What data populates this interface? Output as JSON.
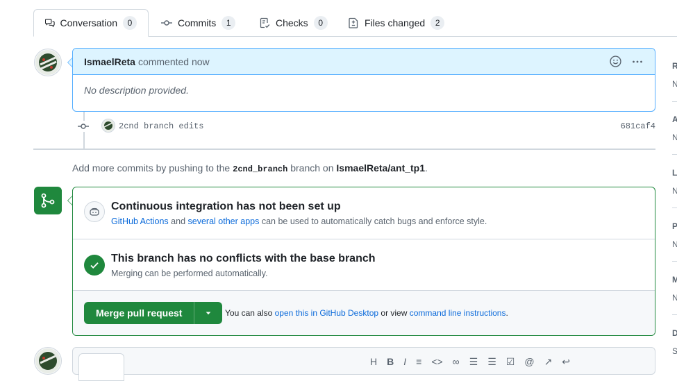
{
  "tabs": [
    {
      "label": "Conversation",
      "count": "0",
      "icon": "comment-discussion-icon"
    },
    {
      "label": "Commits",
      "count": "1",
      "icon": "git-commit-icon"
    },
    {
      "label": "Checks",
      "count": "0",
      "icon": "checklist-icon"
    },
    {
      "label": "Files changed",
      "count": "2",
      "icon": "file-diff-icon"
    }
  ],
  "comment": {
    "author": "IsmaelReta",
    "meta": "commented now",
    "body": "No description provided."
  },
  "commit": {
    "message": "2cnd branch edits",
    "sha": "681caf4"
  },
  "hint": {
    "prefix": "Add more commits by pushing to the",
    "branch": "2cnd_branch",
    "middle": "branch on",
    "repo": "IsmaelReta/ant_tp1",
    "suffix": "."
  },
  "ci": {
    "title": "Continuous integration has not been set up",
    "link1": "GitHub Actions",
    "and": "and",
    "link2": "several other apps",
    "rest": "can be used to automatically catch bugs and enforce style."
  },
  "conflicts": {
    "title": "This branch has no conflicts with the base branch",
    "sub": "Merging can be performed automatically."
  },
  "merge": {
    "button": "Merge pull request",
    "also_prefix": "You can also",
    "desktop_link": "open this in GitHub Desktop",
    "or_view": "or view",
    "cli_link": "command line instructions",
    "suffix": "."
  },
  "sidebar": {
    "items": [
      {
        "head": "R",
        "value": "N"
      },
      {
        "head": "A",
        "value": "N"
      },
      {
        "head": "L",
        "value": "N"
      },
      {
        "head": "P",
        "value": "N"
      },
      {
        "head": "M",
        "value": "N"
      },
      {
        "head": "D",
        "value": "S"
      }
    ]
  },
  "colors": {
    "accent": "#0969da",
    "success": "#1f883d",
    "comment_header": "#ddf4ff",
    "comment_border": "#54aeff"
  }
}
